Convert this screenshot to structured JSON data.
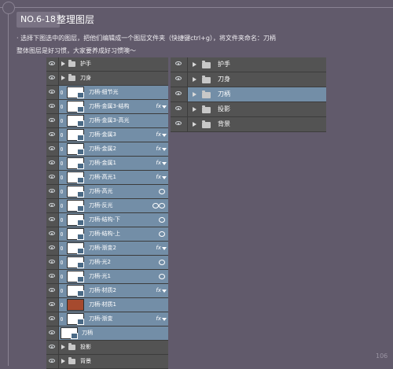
{
  "header": {
    "badge": "NO.6-18",
    "title": "整理图层"
  },
  "intro": {
    "line1": "· 选择下图选中的图层，把他们编辑成一个图层文件夹（快捷键ctrl+g），将文件夹命名：刀柄",
    "line2": "整体图层是好习惯，大家要养成好习惯噢～"
  },
  "left_panel": {
    "top_groups": [
      {
        "label": "护手"
      },
      {
        "label": "刀身"
      }
    ],
    "selected_layers": [
      {
        "label": "刀柄-细节光",
        "fx": ""
      },
      {
        "label": "刀柄-金属3-结构",
        "fx": "fx"
      },
      {
        "label": "刀柄-金属3-高光",
        "fx": ""
      },
      {
        "label": "刀柄-金属3",
        "fx": "fx"
      },
      {
        "label": "刀柄-金属2",
        "fx": "fx"
      },
      {
        "label": "刀柄-金属1",
        "fx": "fx"
      },
      {
        "label": "刀柄-高光1",
        "fx": "fx"
      },
      {
        "label": "刀柄-高光",
        "fx": ""
      },
      {
        "label": "刀柄-反光",
        "fx": ""
      },
      {
        "label": "刀柄-结构-下",
        "fx": ""
      },
      {
        "label": "刀柄-结构-上",
        "fx": ""
      },
      {
        "label": "刀柄-渐变2",
        "fx": "fx"
      },
      {
        "label": "刀柄-光2",
        "fx": ""
      },
      {
        "label": "刀柄-光1",
        "fx": ""
      },
      {
        "label": "刀柄-材质2",
        "fx": "fx"
      },
      {
        "label": "刀柄-材质1",
        "fx": ""
      },
      {
        "label": "刀柄-渐变",
        "fx": "fx"
      },
      {
        "label": "刀柄",
        "fx": ""
      }
    ],
    "bottom_groups": [
      {
        "label": "投影"
      },
      {
        "label": "背景"
      }
    ]
  },
  "right_panel": {
    "groups": [
      {
        "label": "护手"
      },
      {
        "label": "刀身"
      },
      {
        "label": "刀柄"
      },
      {
        "label": "投影"
      },
      {
        "label": "背景"
      }
    ]
  },
  "footer": {
    "page_number": "106"
  }
}
